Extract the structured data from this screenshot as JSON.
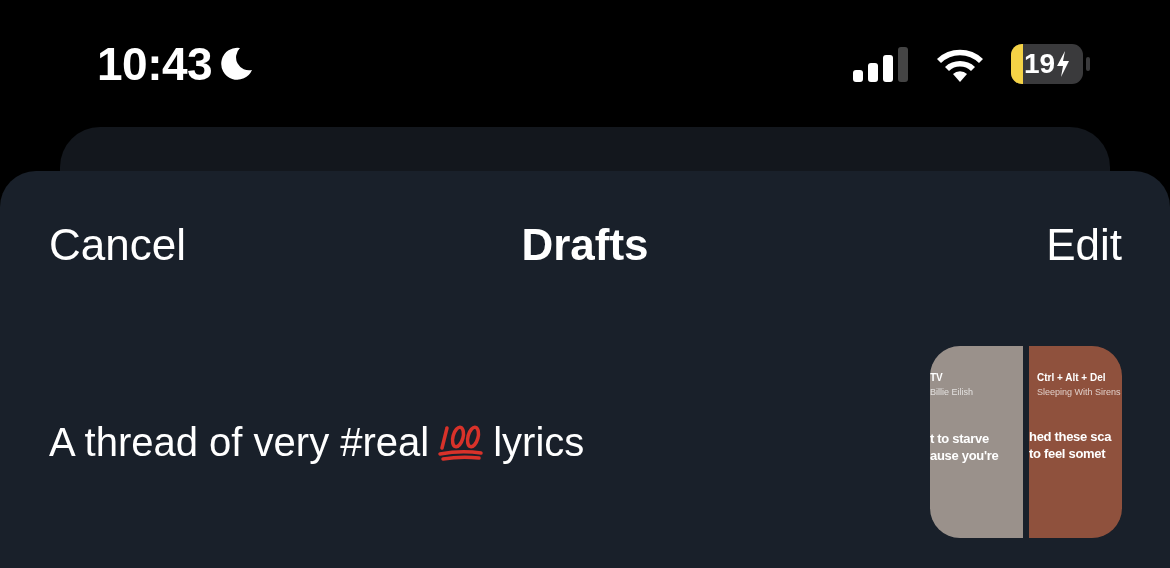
{
  "status_bar": {
    "time": "10:43",
    "battery": "19"
  },
  "nav": {
    "cancel": "Cancel",
    "title": "Drafts",
    "edit": "Edit"
  },
  "drafts": [
    {
      "title_before": "A thread of very #real",
      "title_after": "lyrics",
      "cards": [
        {
          "song": "TV",
          "artist": "Billie Eilish",
          "lyrics": [
            "t to starve",
            "ause you're"
          ],
          "color": "#9a918b"
        },
        {
          "song": "Ctrl + Alt + Del",
          "artist": "Sleeping With Sirens",
          "lyrics": [
            "hed these sca",
            "to feel somet"
          ],
          "color": "#8f513d"
        }
      ]
    }
  ]
}
